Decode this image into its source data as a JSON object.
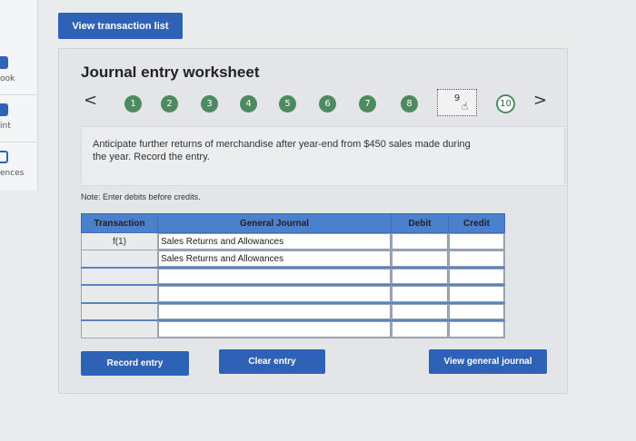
{
  "sidebar": {
    "items": [
      {
        "label": "ook"
      },
      {
        "label": "int"
      },
      {
        "label": "ences"
      }
    ]
  },
  "header": {
    "view_list_label": "View transaction list"
  },
  "worksheet": {
    "title": "Journal entry worksheet",
    "prev_arrow": "<",
    "next_arrow": ">",
    "steps": [
      "1",
      "2",
      "3",
      "4",
      "5",
      "6",
      "7",
      "8",
      "9",
      "10"
    ],
    "active_step": "9",
    "question": "Anticipate further returns of merchandise after year-end from $450 sales made during the year. Record the entry.",
    "note": "Note: Enter debits before credits."
  },
  "journal": {
    "headers": {
      "transaction": "Transaction",
      "general_journal": "General Journal",
      "debit": "Debit",
      "credit": "Credit"
    },
    "rows": [
      {
        "transaction": "f(1)",
        "account": "Sales Returns and Allowances",
        "debit": "",
        "credit": ""
      },
      {
        "transaction": "",
        "account": "Sales Returns and Allowances",
        "debit": "",
        "credit": ""
      },
      {
        "transaction": "",
        "account": "",
        "debit": "",
        "credit": ""
      },
      {
        "transaction": "",
        "account": "",
        "debit": "",
        "credit": ""
      },
      {
        "transaction": "",
        "account": "",
        "debit": "",
        "credit": ""
      },
      {
        "transaction": "",
        "account": "",
        "debit": "",
        "credit": ""
      }
    ]
  },
  "actions": {
    "record_label": "Record entry",
    "clear_label": "Clear entry",
    "view_journal_label": "View general journal"
  },
  "colors": {
    "accent": "#2e62b6",
    "step_done": "#4e8a5f",
    "table_header": "#4a80cc"
  }
}
